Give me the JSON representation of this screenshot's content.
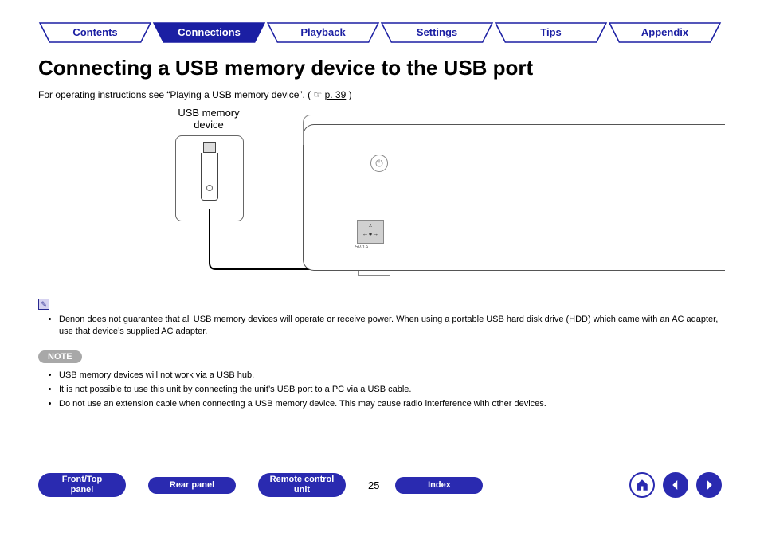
{
  "topnav": {
    "items": [
      {
        "label": "Contents",
        "active": false
      },
      {
        "label": "Connections",
        "active": true
      },
      {
        "label": "Playback",
        "active": false
      },
      {
        "label": "Settings",
        "active": false
      },
      {
        "label": "Tips",
        "active": false
      },
      {
        "label": "Appendix",
        "active": false
      }
    ]
  },
  "title": "Connecting a USB memory device to the USB port",
  "intro": {
    "prefix": "For operating instructions see “Playing a USB memory device”.  (",
    "page_ref": "p. 39",
    "suffix": ")"
  },
  "diagram": {
    "usb_label_line1": "USB memory",
    "usb_label_line2": "device",
    "port_label": "5V/1A"
  },
  "info_bullets": [
    "Denon does not guarantee that all USB memory devices will operate or receive power. When using a portable USB hard disk drive (HDD) which came with an AC adapter, use that device’s supplied AC adapter."
  ],
  "note_label": "NOTE",
  "note_bullets": [
    "USB memory devices will not work via a USB hub.",
    "It is not possible to use this unit by connecting the unit’s USB port to a PC via a USB cable.",
    "Do not use an extension cable when connecting a USB memory device. This may cause radio interference with other devices."
  ],
  "footer": {
    "buttons": [
      {
        "line1": "Front/Top",
        "line2": "panel"
      },
      {
        "line1": "Rear panel",
        "line2": ""
      },
      {
        "line1": "Remote control",
        "line2": "unit"
      }
    ],
    "page_number": "25",
    "index_label": "Index"
  }
}
